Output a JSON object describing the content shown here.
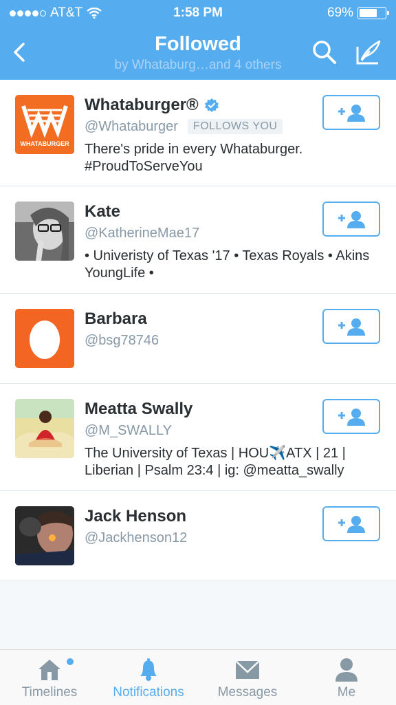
{
  "status_bar": {
    "carrier": "AT&T",
    "time": "1:58 PM",
    "battery": "69%",
    "battery_level": 0.69
  },
  "nav": {
    "title": "Followed",
    "subtitle": "by Whataburg…and 4 others"
  },
  "users": [
    {
      "name": "Whataburger®",
      "handle": "@Whataburger",
      "verified": true,
      "follows_you": "FOLLOWS YOU",
      "bio": "There's pride in every Whataburger. #ProudToServeYou",
      "avatar_text": "WHATABURGER",
      "avatar_color": "#f26d21"
    },
    {
      "name": "Kate",
      "handle": "@KatherineMae17",
      "bio": "• Univeristy of Texas '17 • Texas Royals • Akins YoungLife •"
    },
    {
      "name": "Barbara",
      "handle": "@bsg78746",
      "bio": "",
      "avatar_color": "#f26522"
    },
    {
      "name": "Meatta Swally",
      "handle": "@M_SWALLY",
      "bio": "The University of Texas | HOU✈️ATX | 21 | Liberian | Psalm 23:4 | ig: @meatta_swally"
    },
    {
      "name": "Jack Henson",
      "handle": "@Jackhenson12",
      "bio": ""
    }
  ],
  "tabs": [
    {
      "label": "Timelines",
      "icon": "home-icon"
    },
    {
      "label": "Notifications",
      "icon": "bell-icon"
    },
    {
      "label": "Messages",
      "icon": "envelope-icon"
    },
    {
      "label": "Me",
      "icon": "person-icon"
    }
  ],
  "colors": {
    "accent": "#55acee",
    "text": "#292f33",
    "muted": "#8899a6"
  }
}
